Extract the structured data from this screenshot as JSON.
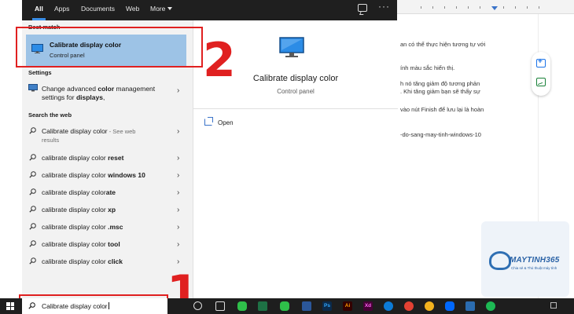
{
  "tabs": [
    {
      "label": "All",
      "active": true
    },
    {
      "label": "Apps"
    },
    {
      "label": "Documents"
    },
    {
      "label": "Web"
    },
    {
      "label": "More"
    }
  ],
  "sections": {
    "best_match": "Best match",
    "settings": "Settings",
    "search_web": "Search the web"
  },
  "best_match": {
    "title": "Calibrate display color",
    "subtitle": "Control panel",
    "icon": "monitor-icon"
  },
  "settings_item": {
    "parts": [
      {
        "text": "Change advanced ",
        "bold": false
      },
      {
        "text": "color",
        "bold": true
      },
      {
        "text": " management settings for ",
        "bold": false
      },
      {
        "text": "displays",
        "bold": true
      },
      {
        "text": ",",
        "bold": false
      }
    ]
  },
  "web_results": [
    {
      "base": "Calibrate display color",
      "bold": "",
      "suffix": " - See web",
      "sub": "results"
    },
    {
      "base": "calibrate display color ",
      "bold": "reset"
    },
    {
      "base": "calibrate display color ",
      "bold": "windows 10"
    },
    {
      "base": "calibrate display color",
      "bold": "ate"
    },
    {
      "base": "calibrate display color ",
      "bold": "xp"
    },
    {
      "base": "calibrate display color ",
      "bold": ".msc"
    },
    {
      "base": "calibrate display color ",
      "bold": "tool"
    },
    {
      "base": "calibrate display color ",
      "bold": "click"
    }
  ],
  "detail": {
    "title": "Calibrate display color",
    "subtitle": "Control panel",
    "action": "Open"
  },
  "taskbar": {
    "search_text": "Calibrate display color",
    "apps": [
      {
        "icon": "cortana-icon",
        "color": "#1e1e1e"
      },
      {
        "icon": "task-view-icon",
        "color": "#1e1e1e"
      },
      {
        "icon": "line-icon",
        "color": "#2fbf4a"
      },
      {
        "icon": "excel-icon",
        "color": "#1e7145"
      },
      {
        "icon": "word-icon",
        "color": "#2b579a"
      },
      {
        "icon": "photoshop-icon",
        "color": "#0b2a4a",
        "label": "Ps"
      },
      {
        "icon": "illustrator-icon",
        "color": "#330000",
        "label": "Ai"
      },
      {
        "icon": "xd-icon",
        "color": "#470137",
        "label": "Xd"
      },
      {
        "icon": "edge-icon",
        "color": "#0c7bd6"
      },
      {
        "icon": "chrome-icon",
        "color": "#e34133"
      },
      {
        "icon": "chrome-alt-icon",
        "color": "#f2b21e"
      },
      {
        "icon": "zalo-icon",
        "color": "#0068ff"
      },
      {
        "icon": "photos-icon",
        "color": "#2b6cb0"
      },
      {
        "icon": "spotify-icon",
        "color": "#1db954"
      }
    ]
  },
  "annotations": {
    "step1": "1",
    "step2": "2"
  },
  "background_doc": {
    "lines": [
      "an có thể thực hiện tương tự với",
      "ính màu sắc hiển thị.",
      "h nó tăng giảm độ tương phản",
      ". Khi tăng giảm bạn sẽ thấy sự",
      "vào nút Finish để lưu lại là hoàn",
      "-do-sang-may-tinh-windows-10"
    ]
  },
  "logo": {
    "name": "MAYTINH365",
    "tagline": "Chia sẻ & Thủ thuật máy tính"
  }
}
